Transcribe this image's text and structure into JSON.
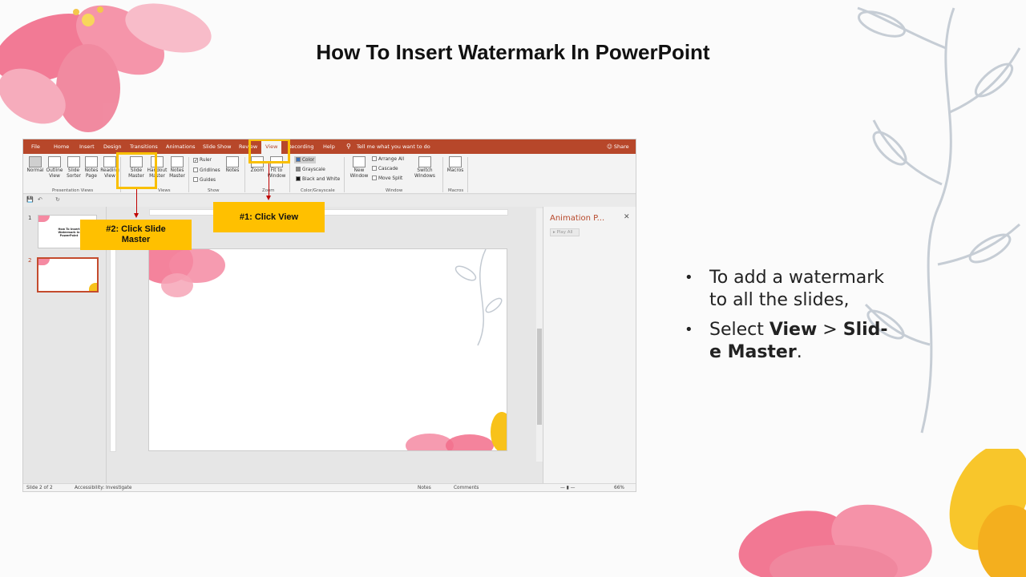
{
  "title": "How To Insert Watermark In PowerPoint",
  "screenshot": {
    "menu_tabs": [
      {
        "label": "File",
        "active": false
      },
      {
        "label": "Home",
        "active": false
      },
      {
        "label": "Insert",
        "active": false
      },
      {
        "label": "Design",
        "active": false
      },
      {
        "label": "Transitions",
        "active": false
      },
      {
        "label": "Animations",
        "active": false
      },
      {
        "label": "Slide Show",
        "active": false
      },
      {
        "label": "Review",
        "active": false
      },
      {
        "label": "View",
        "active": true
      },
      {
        "label": "Recording",
        "active": false
      },
      {
        "label": "Help",
        "active": false
      }
    ],
    "tell_me": "Tell me what you want to do",
    "share": "Share",
    "ribbon": {
      "presentation_views": {
        "label": "Presentation Views",
        "buttons": [
          "Normal",
          "Outline View",
          "Slide Sorter",
          "Notes Page",
          "Reading View"
        ]
      },
      "master_views": {
        "label": "Views",
        "buttons": [
          "Slide Master",
          "Handout Master",
          "Notes Master"
        ]
      },
      "show": {
        "label": "Show",
        "checks": [
          "Ruler",
          "Gridlines",
          "Guides"
        ],
        "notes": "Notes"
      },
      "zoom": {
        "label": "Zoom",
        "buttons": [
          "Zoom",
          "Fit to Window"
        ]
      },
      "color": {
        "label": "Color/Grayscale",
        "items": [
          "Color",
          "Grayscale",
          "Black and White"
        ]
      },
      "window": {
        "label": "Window",
        "new_window": "New Window",
        "items": [
          "Arrange All",
          "Cascade",
          "Move Split"
        ],
        "switch": "Switch Windows"
      },
      "macros": {
        "label": "Macros",
        "button": "Macros"
      }
    },
    "slides": [
      "1",
      "2"
    ],
    "thumb1_text": "How To Insert Watermark In PowerPoint",
    "animation_pane": {
      "title": "Animation P...",
      "play_all": "Play All"
    },
    "status": {
      "slide": "Slide 2 of 2",
      "accessibility": "Accessibility: Investigate",
      "notes": "Notes",
      "comments": "Comments",
      "zoom": "66%"
    }
  },
  "callouts": {
    "view": "#1: Click View",
    "slide_master": "#2: Click Slide Master"
  },
  "bullets": [
    {
      "text_before": "To add a watermark to all the slides,"
    },
    {
      "text_before": "Select ",
      "bold1": "View",
      "middle": " > ",
      "bold2": "Slid­e Master",
      "after": "."
    }
  ],
  "colors": {
    "ppt_accent": "#b7472a",
    "callout": "#ffc000",
    "highlight_border": "#f9bf00",
    "arrow": "#c00000"
  }
}
